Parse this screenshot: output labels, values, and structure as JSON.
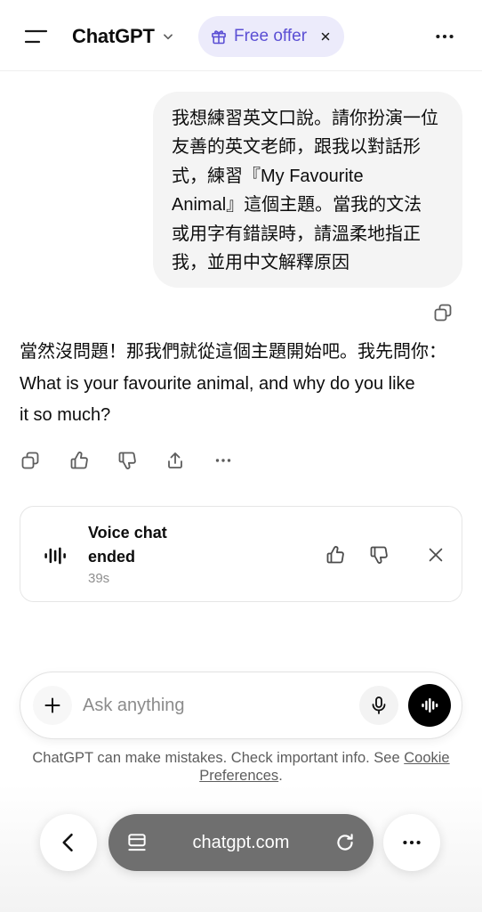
{
  "header": {
    "title": "ChatGPT",
    "offer_label": "Free offer"
  },
  "conversation": {
    "user_message": {
      "lines": [
        "我想練習英文口說。請你扮演一位",
        "友善的英文老師，跟我以對話形",
        "式，練習『My Favourite",
        "Animal』這個主題。當我的文法",
        "或用字有錯誤時，請溫柔地指正",
        "我，並用中文解釋原因"
      ]
    },
    "assistant_message": {
      "lines": [
        "當然沒問題！那我們就從這個主題開始吧。我先問你：",
        "What is your favourite animal, and why do you like",
        "it so much?"
      ]
    }
  },
  "voice_chat": {
    "status": "Voice chat ended",
    "duration": "39s"
  },
  "composer": {
    "placeholder": "Ask anything"
  },
  "disclaimer": {
    "text": "ChatGPT can make mistakes. Check important info. See",
    "link": "Cookie Preferences",
    "suffix": "."
  },
  "browser_bar": {
    "url": "chatgpt.com"
  },
  "icons": {
    "menu": "menu-icon",
    "model_dropdown": "chevron-down-icon",
    "offer": "gift-icon",
    "offer_close": "close-icon",
    "more": "ellipsis-icon",
    "copy": "copy-icon",
    "like": "thumbs-up-icon",
    "dislike": "thumbs-down-icon",
    "share": "share-icon",
    "voice_chat": "waveform-icon",
    "dismiss": "close-icon",
    "add": "plus-icon",
    "dictate": "microphone-icon",
    "voice_mode": "voice-mode-icon",
    "back": "chevron-left-icon",
    "tabs": "tabs-icon",
    "reload": "reload-icon"
  },
  "colors": {
    "offer_background": "#ECEBFB",
    "offer_text": "#5B4FD4",
    "user_bubble": "#F4F4F4",
    "voice_button": "#000000",
    "url_pill": "#6F6F6F",
    "text_primary": "#0D0D0D",
    "text_secondary": "#8F8F8F"
  }
}
